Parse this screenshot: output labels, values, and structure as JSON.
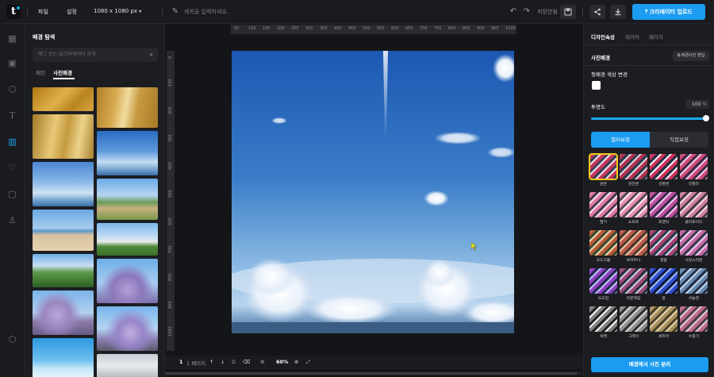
{
  "header": {
    "menu_file": "파일",
    "menu_settings": "설정",
    "canvas_size": "1080 x 1080 px",
    "title_placeholder": "제목을 입력하세요.",
    "save_status": "저장안됨",
    "upload_label": "크리에이터 업로드"
  },
  "left_panel": {
    "title": "배경 탐색",
    "search_placeholder": "태그 또는 @크리에이터 검색",
    "tabs": [
      "패턴",
      "사진배경"
    ],
    "active_tab": "사진배경"
  },
  "canvas": {
    "ruler_top": [
      "50",
      "100",
      "165",
      "200",
      "255",
      "300",
      "365",
      "400",
      "465",
      "500",
      "565",
      "600",
      "665",
      "700",
      "765",
      "800",
      "865",
      "900",
      "965",
      "1000"
    ],
    "ruler_left": [
      "0",
      "100",
      "200",
      "300",
      "400",
      "500",
      "600",
      "700",
      "800",
      "900",
      "1000"
    ],
    "page_number": "1",
    "page_label": "1 페이지",
    "zoom": "60%"
  },
  "right_panel": {
    "tabs": [
      "디자인속성",
      "레이어",
      "페이지"
    ],
    "active_tab": "디자인속성",
    "section_title": "사진배경",
    "edit_button": "배경사진 편집",
    "bg_color_label": "뒷배경 색상 변경",
    "opacity_label": "투명도",
    "opacity_value": "100",
    "opacity_unit": "%",
    "seg_filter": "필터보정",
    "seg_detail": "직접보정",
    "filters": [
      "원본",
      "전전변",
      "선명변",
      "리필터",
      "딸기",
      "소프트",
      "포멘틱",
      "플라로이드",
      "코드크롬",
      "브라우니",
      "열람",
      "사망스러운",
      "도드런",
      "차분해짐",
      "광",
      "서늘한",
      "흑백",
      "그레이",
      "세피아",
      "수중기"
    ],
    "selected_filter": "원본",
    "separate_button": "배경에서 사진 분리"
  },
  "colors": {
    "accent": "#1b9cf0",
    "panel_bg": "#1c1d21",
    "canvas_bg": "#141519",
    "selected_outline": "#f3c51a"
  }
}
